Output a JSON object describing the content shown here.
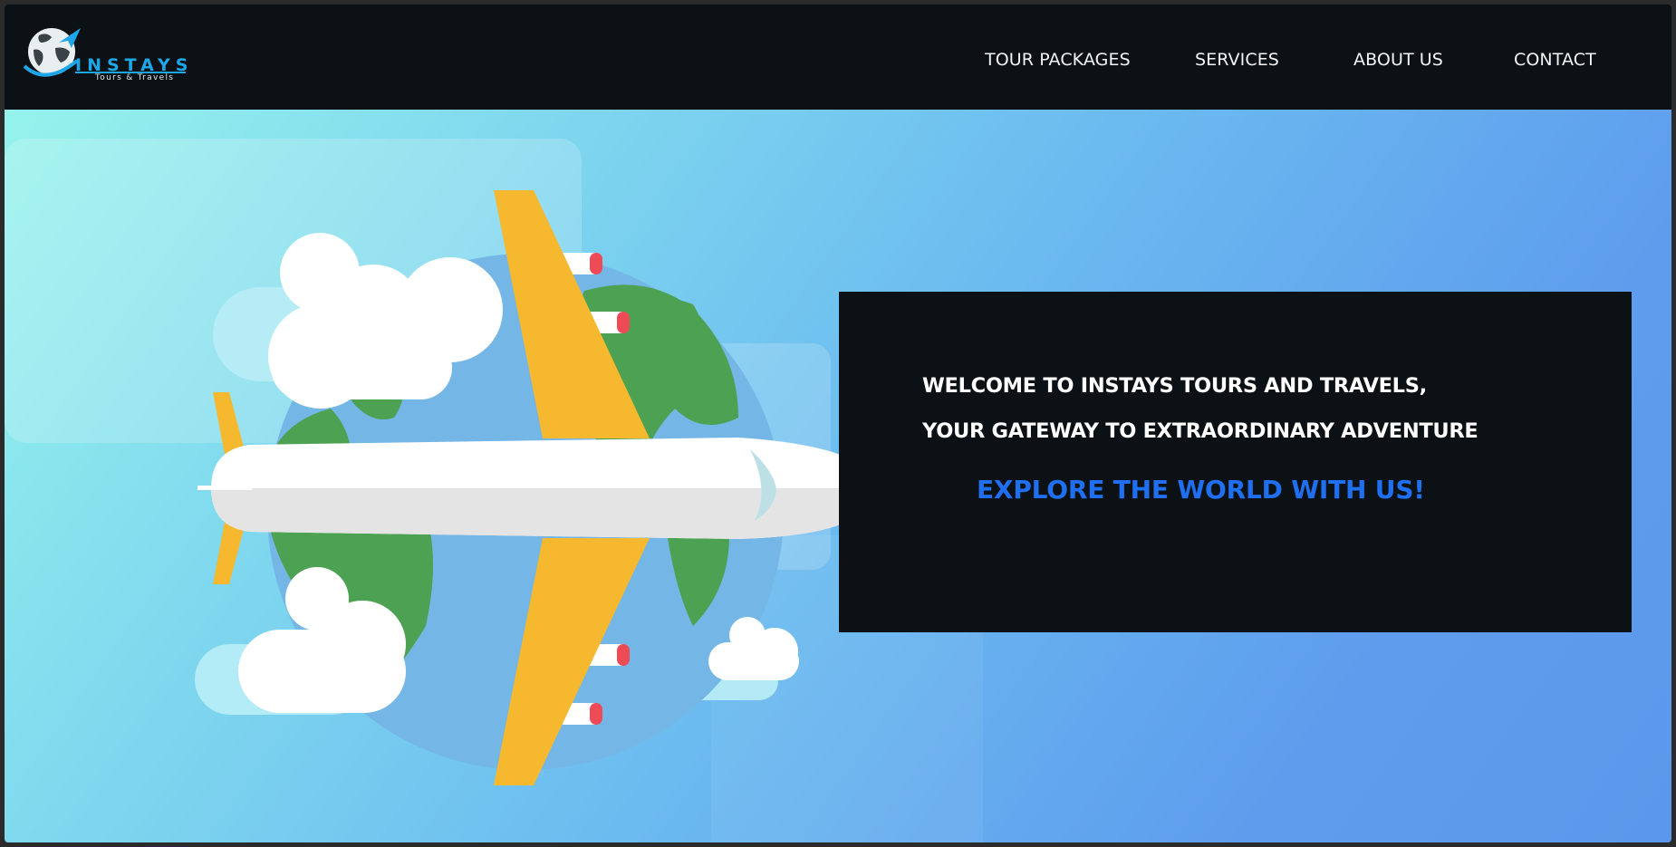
{
  "brand": {
    "name": "INSTAYS",
    "tagline": "Tours & Travels"
  },
  "nav": {
    "items": [
      {
        "label": "TOUR PACKAGES"
      },
      {
        "label": "SERVICES"
      },
      {
        "label": "ABOUT US"
      },
      {
        "label": "CONTACT"
      }
    ]
  },
  "hero": {
    "welcome_line1": "WELCOME TO INSTAYS TOURS AND TRAVELS,",
    "welcome_line2": "YOUR GATEWAY TO EXTRAORDINARY ADVENTURE",
    "cta": "EXPLORE THE WORLD WITH US!"
  },
  "colors": {
    "navbar_bg": "#0b1114",
    "accent_blue": "#1f6ff0",
    "logo_blue": "#1ea7e8",
    "plane_wing": "#f5b82e",
    "globe_ocean": "#74b6e6",
    "globe_land": "#4da152"
  }
}
